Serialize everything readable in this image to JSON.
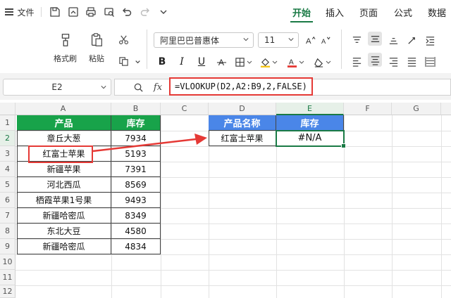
{
  "menubar": {
    "file_label": "文件",
    "tabs": [
      {
        "label": "开始",
        "active": true
      },
      {
        "label": "插入",
        "active": false
      },
      {
        "label": "页面",
        "active": false
      },
      {
        "label": "公式",
        "active": false
      },
      {
        "label": "数据",
        "active": false
      }
    ],
    "quick_icons": [
      "save-icon",
      "export-icon",
      "print-icon",
      "print-preview-icon",
      "undo-icon",
      "redo-icon",
      "more-chevron-icon"
    ]
  },
  "ribbon": {
    "format_painter": "格式刷",
    "paste": "粘贴",
    "font_name": "阿里巴巴普惠体",
    "font_size": "11",
    "format_buttons": [
      "B",
      "I",
      "U"
    ]
  },
  "formula_bar": {
    "cell_ref": "E2",
    "fx": "fx",
    "formula": "=VLOOKUP(D2,A2:B9,2,FALSE)"
  },
  "sheet": {
    "columns": [
      "A",
      "B",
      "C",
      "D",
      "E",
      "F",
      "G"
    ],
    "rows": [
      "1",
      "2",
      "3",
      "4",
      "5",
      "6",
      "7",
      "8",
      "9",
      "10",
      "11",
      "12"
    ],
    "table": {
      "headers": [
        "产品",
        "库存"
      ],
      "rows": [
        [
          "章丘大葱",
          "7934"
        ],
        [
          "红富士苹果",
          "5193"
        ],
        [
          "新疆苹果",
          "7391"
        ],
        [
          "河北西瓜",
          "8569"
        ],
        [
          "栖霞苹果1号果",
          "9493"
        ],
        [
          "新疆哈密瓜",
          "8349"
        ],
        [
          "东北大豆",
          "4580"
        ],
        [
          "新疆哈密瓜",
          "4834"
        ]
      ]
    },
    "lookup": {
      "headers": [
        "产品名称",
        "库存"
      ],
      "name": "红富士苹果",
      "result": "#N/A"
    }
  },
  "colors": {
    "accent_green": "#1a7a45",
    "header_green": "#18a34a",
    "header_blue": "#4a86e8",
    "highlight_red": "#e53935"
  }
}
